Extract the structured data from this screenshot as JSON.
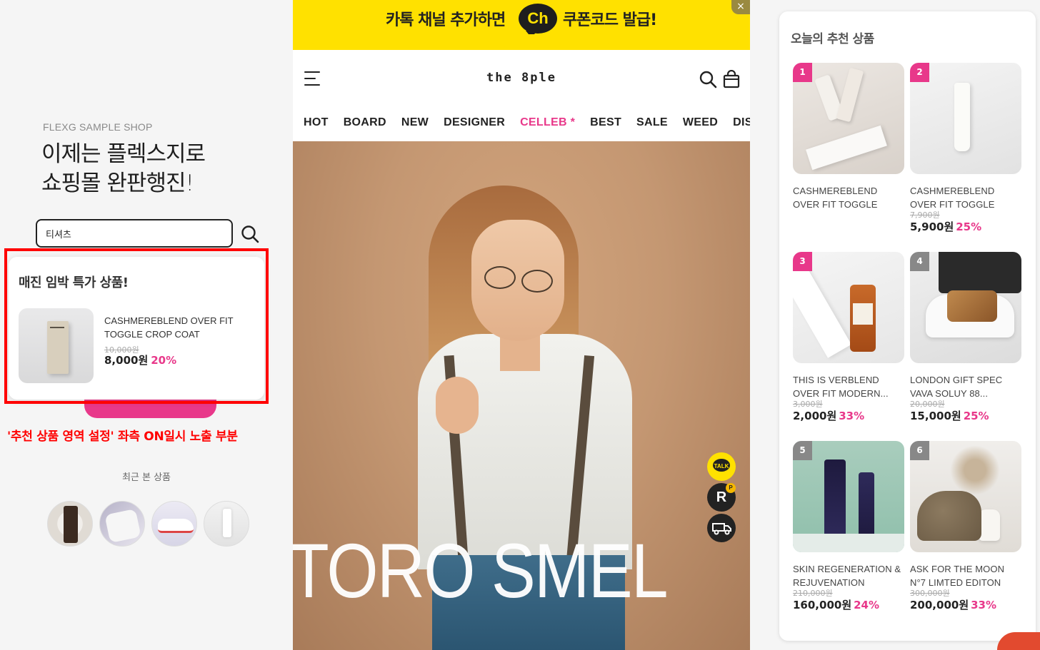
{
  "left": {
    "shop_label": "FLEXG SAMPLE SHOP",
    "headline_line1": "이제는 플렉스지로",
    "headline_line2": "쇼핑몰 완판행진!",
    "search_value": "티셔츠",
    "deal": {
      "title": "매진 임박 특가 상품!",
      "name": "CASHMEREBLEND OVER FIT TOGGLE CROP COAT",
      "old_price": "10,000원",
      "price": "8,000원",
      "discount": "20%"
    },
    "annotation": "'추천 상품 영역 설정' 좌측 ON일시 노출 부분",
    "recent_label": "최근 본 상품"
  },
  "mobile": {
    "banner_left": "카톡 채널 추가하면",
    "banner_ch": "Ch",
    "banner_right": "쿠폰코드 발급!",
    "banner_close": "×",
    "logo": "the 8ple",
    "nav": [
      "HOT",
      "BOARD",
      "NEW",
      "DESIGNER",
      "CELLEB *",
      "BEST",
      "SALE",
      "WEED",
      "DISCO"
    ],
    "hero_text": "TORO SMEL",
    "float_talk": "TALK",
    "float_r": "R",
    "float_r_badge": "P"
  },
  "recommend": {
    "title": "오늘의 추천 상품",
    "items": [
      {
        "rank": "1",
        "name": "CASHMEREBLEND OVER FIT TOGGLE CROP COAT",
        "old_price": "",
        "price": "",
        "discount": ""
      },
      {
        "rank": "2",
        "name": "CASHMEREBLEND OVER FIT TOGGLE CROP COAT",
        "old_price": "7,900원",
        "price": "5,900원",
        "discount": "25%"
      },
      {
        "rank": "3",
        "name": "THIS IS VERBLEND OVER FIT MODERN...",
        "old_price": "3,000원",
        "price": "2,000원",
        "discount": "33%"
      },
      {
        "rank": "4",
        "name": "LONDON GIFT SPEC VAVA SOLUY 88...",
        "old_price": "20,000원",
        "price": "15,000원",
        "discount": "25%"
      },
      {
        "rank": "5",
        "name": "SKIN REGENERATION & REJUVENATION",
        "old_price": "210,000원",
        "price": "160,000원",
        "discount": "24%"
      },
      {
        "rank": "6",
        "name": "ASK FOR THE MOON N°7 LIMTED EDITON",
        "old_price": "300,000원",
        "price": "200,000원",
        "discount": "33%"
      }
    ]
  },
  "colors": {
    "accent_pink": "#e8388a",
    "kakao_yellow": "#ffe100",
    "highlight_red": "#ff0000"
  }
}
